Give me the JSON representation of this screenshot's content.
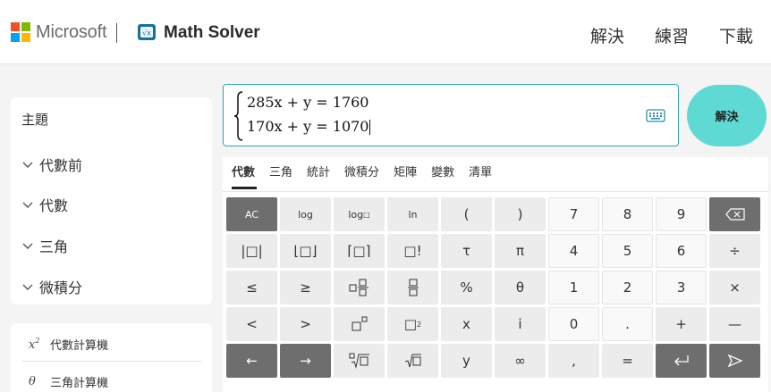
{
  "header": {
    "brand": "Microsoft",
    "product": "Math Solver",
    "nav": [
      "解決",
      "練習",
      "下載"
    ]
  },
  "colors": {
    "accent": "#5ed9d4",
    "input_border": "#2aa4b8",
    "ms_red": "#f25022",
    "ms_green": "#7fba00",
    "ms_blue": "#00a4ef",
    "ms_yellow": "#ffb900"
  },
  "sidebar": {
    "title": "主題",
    "topics": [
      "代數前",
      "代數",
      "三角",
      "微積分"
    ],
    "calculators": [
      {
        "icon": "x²",
        "label": "代數計算機"
      },
      {
        "icon": "θ",
        "label": "三角計算機"
      }
    ]
  },
  "input": {
    "line1": "285x + y = 1760",
    "line2": "170x + y = 1070",
    "keyboard_icon": "keyboard-icon"
  },
  "solve_button": "解決",
  "keypad": {
    "tabs": [
      "代數",
      "三角",
      "統計",
      "微積分",
      "矩陣",
      "變數",
      "清單"
    ],
    "active_tab": "代數",
    "keys": {
      "ac": "AC",
      "log": "log",
      "log_n": "log",
      "ln": "ln",
      "lparen": "(",
      "rparen": ")",
      "d7": "7",
      "d8": "8",
      "d9": "9",
      "abs": "|□|",
      "floor": "⌊□⌋",
      "ceil": "⌈□⌉",
      "fact": "□!",
      "tau": "τ",
      "pi": "π",
      "d4": "4",
      "d5": "5",
      "d6": "6",
      "div": "÷",
      "le": "≤",
      "ge": "≥",
      "pct": "%",
      "theta": "θ",
      "d1": "1",
      "d2": "2",
      "d3": "3",
      "mul": "×",
      "lt": "<",
      "gt": ">",
      "sq_box": "□",
      "sq_two": "2",
      "x": "x",
      "i": "i",
      "d0": "0",
      "dot": ".",
      "plus": "+",
      "minus": "—",
      "left": "←",
      "right": "→",
      "y": "y",
      "inf": "∞",
      "comma": ",",
      "eq": "="
    }
  }
}
